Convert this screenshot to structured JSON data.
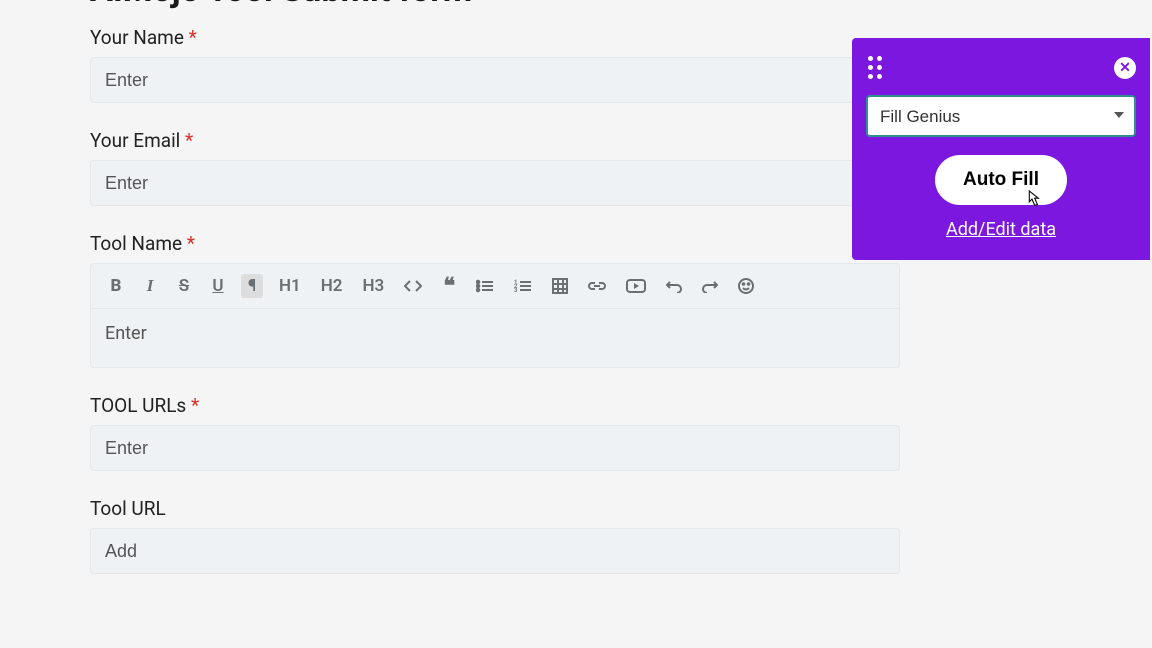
{
  "page": {
    "title": "AIMojo Tool Submit form"
  },
  "form": {
    "your_name": {
      "label": "Your Name",
      "required": true,
      "placeholder": "Enter"
    },
    "your_email": {
      "label": "Your Email",
      "required": true,
      "placeholder": "Enter"
    },
    "tool_name": {
      "label": "Tool Name",
      "required": true,
      "placeholder": "Enter"
    },
    "tool_urls": {
      "label": "TOOL URLs",
      "required": true,
      "placeholder": "Enter"
    },
    "tool_url": {
      "label": "Tool URL",
      "required": false,
      "placeholder": "Add"
    }
  },
  "editor_toolbar": {
    "bold": "B",
    "italic": "I",
    "strike": "S",
    "underline": "U",
    "h1": "H1",
    "h2": "H2",
    "h3": "H3",
    "quote": "❝"
  },
  "extension": {
    "profile_selected": "Fill Genius",
    "autofill_label": "Auto Fill",
    "edit_link_label": "Add/Edit data",
    "close": "✕"
  }
}
